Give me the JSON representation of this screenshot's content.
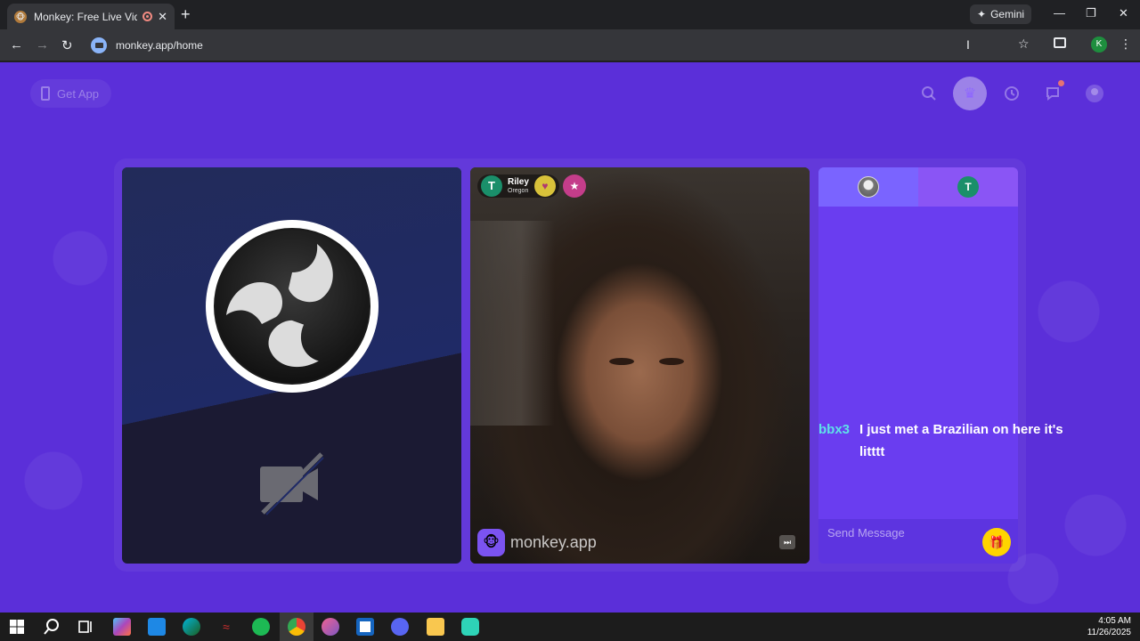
{
  "browser": {
    "tab_title": "Monkey: Free Live Video Ch",
    "tab_close": "✕",
    "new_tab": "+",
    "gemini_label": "Gemini",
    "url": "monkey.app/home",
    "profile_initial": "K"
  },
  "page": {
    "get_app_label": "Get App",
    "remote_user": {
      "initial": "T",
      "name": "Riley",
      "location": "Oregon"
    },
    "brand_text": "monkey.app",
    "chat": {
      "tab_initial": "T",
      "message_sender": "bbx3",
      "message_text": "I just met a Brazilian on here it's litttt",
      "send_placeholder": "Send Message"
    },
    "colors": {
      "background": "#5b2fd9",
      "chat_panel": "#6a3df0",
      "sender": "#5fe0e8",
      "gift_button": "#ffd400"
    }
  },
  "taskbar": {
    "time": "4:05 AM",
    "date": "11/26/2025",
    "icons": [
      "windows-start-icon",
      "search-icon",
      "task-view-icon",
      "copilot-icon",
      "mail-icon",
      "edge-icon",
      "razer-icon",
      "spotify-icon",
      "chrome-icon",
      "itunes-icon",
      "news-icon",
      "discord-icon",
      "file-explorer-icon",
      "app-icon"
    ]
  }
}
